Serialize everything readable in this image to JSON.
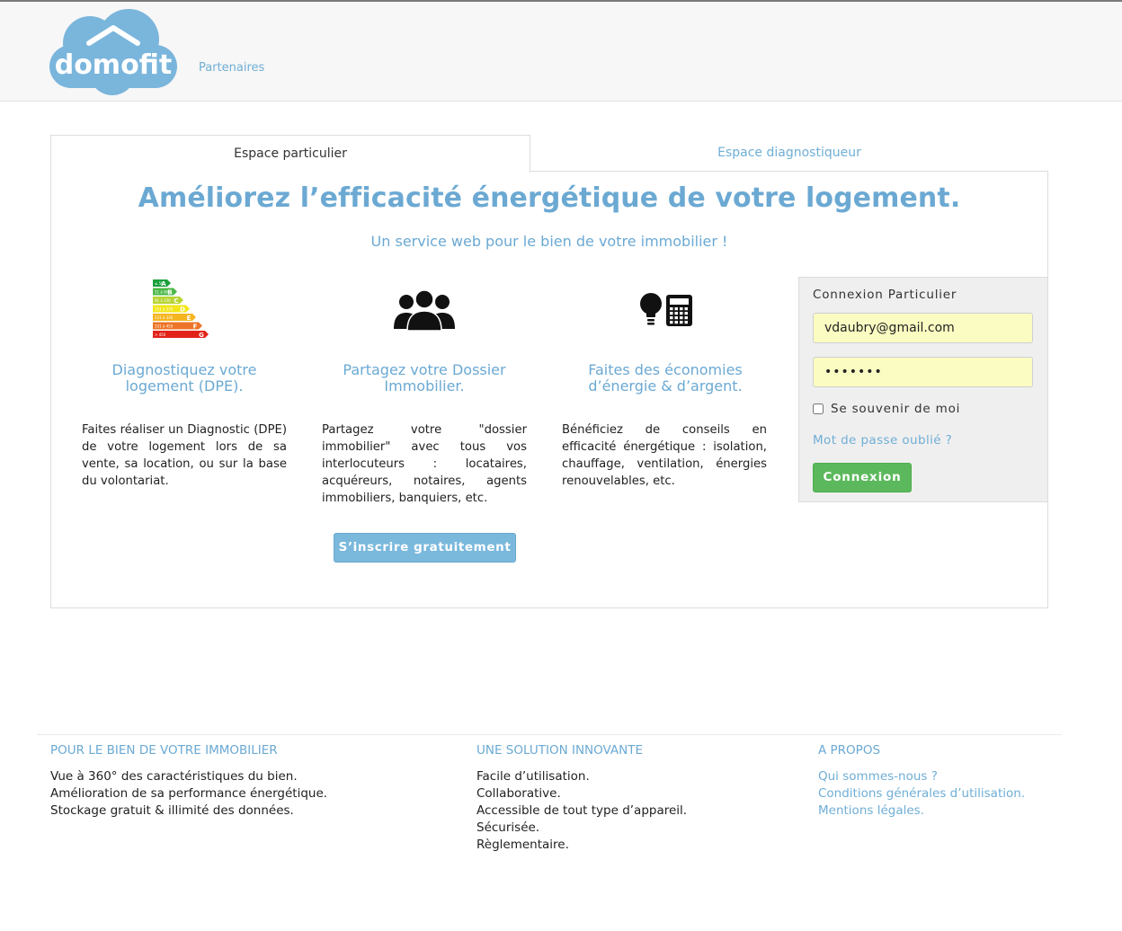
{
  "brand": {
    "name": "domofit"
  },
  "nav": {
    "partners": "Partenaires"
  },
  "tabs": [
    {
      "label": "Espace particulier",
      "active": true
    },
    {
      "label": "Espace diagnostiqueur",
      "active": false
    }
  ],
  "hero": {
    "title": "Améliorez l’efficacité énergétique de votre logement.",
    "subtitle": "Un service web pour le bien de votre immobilier !"
  },
  "features": [
    {
      "icon": "energy-rating-icon",
      "title_line1": "Diagnostiquez votre",
      "title_line2": "logement (DPE).",
      "text": "Faites réaliser un Diagnostic (DPE) de votre logement lors de sa vente, sa location, ou sur la base du volontariat."
    },
    {
      "icon": "people-icon",
      "title_line1": "Partagez votre Dossier",
      "title_line2": "Immobilier.",
      "text": "Partagez votre \"dossier immobilier\" avec tous vos interlocuteurs : locataires, acquéreurs, notaires, agents immobiliers, banquiers, etc."
    },
    {
      "icon": "lightbulb-calculator-icon",
      "title_line1": "Faites des économies",
      "title_line2": "d’énergie & d’argent.",
      "text": "Bénéficiez de conseils en efficacité énergétique : isolation, chauffage, ventilation, énergies renouvelables, etc."
    }
  ],
  "energy_labels": [
    {
      "letter": "A",
      "range": "≤ 50",
      "color": "#1a9f3c"
    },
    {
      "letter": "B",
      "range": "51 à 90",
      "color": "#4cb848"
    },
    {
      "letter": "C",
      "range": "91 à 150",
      "color": "#b6d433"
    },
    {
      "letter": "D",
      "range": "151 à 230",
      "color": "#f2e619"
    },
    {
      "letter": "E",
      "range": "231 à 330",
      "color": "#f5b51f"
    },
    {
      "letter": "F",
      "range": "331 à 450",
      "color": "#ec7428"
    },
    {
      "letter": "G",
      "range": "> 450",
      "color": "#e2231a"
    }
  ],
  "signup": {
    "label": "S’inscrire gratuitement"
  },
  "login": {
    "title": "Connexion Particulier",
    "email_value": "vdaubry@gmail.com",
    "password_value": "•••••••",
    "remember_label": "Se souvenir de moi",
    "forgot_label": "Mot de passe oublié ?",
    "submit_label": "Connexion"
  },
  "footer": {
    "col1": {
      "heading": "POUR LE BIEN DE VOTRE IMMOBILIER",
      "items": [
        "Vue à 360° des caractéristiques du bien.",
        "Amélioration de sa performance énergétique.",
        "Stockage gratuit & illimité des données."
      ]
    },
    "col2": {
      "heading": "UNE SOLUTION INNOVANTE",
      "items": [
        "Facile d’utilisation.",
        "Collaborative.",
        "Accessible de tout type d’appareil.",
        "Sécurisée.",
        "Règlementaire."
      ]
    },
    "col3": {
      "heading": "A PROPOS",
      "links": [
        "Qui sommes-nous ?",
        "Conditions générales d’utilisation.",
        "Mentions légales."
      ]
    }
  },
  "colors": {
    "accent": "#6ba9d3",
    "link": "#6faed6",
    "success": "#5cb85c",
    "autofill": "#fbfcc2"
  }
}
